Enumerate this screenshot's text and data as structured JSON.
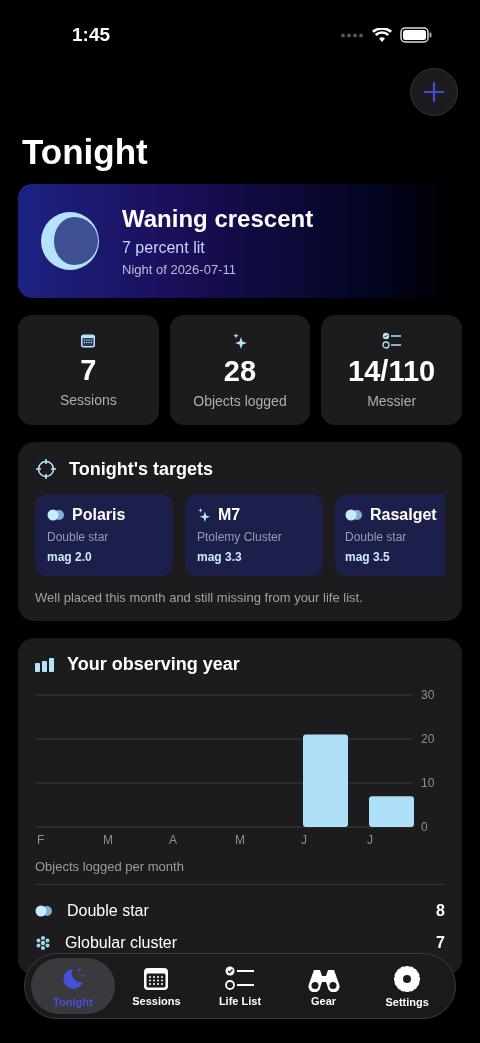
{
  "status_bar": {
    "time": "1:45"
  },
  "title": "Tonight",
  "moon": {
    "phase": "Waning crescent",
    "lit": "7 percent lit",
    "night": "Night of 2026-07-11"
  },
  "stats": [
    {
      "kind": "calendar",
      "value": "7",
      "label": "Sessions"
    },
    {
      "kind": "sparkles",
      "value": "28",
      "label": "Objects logged"
    },
    {
      "kind": "checklist",
      "value": "14/110",
      "label": "Messier"
    }
  ],
  "targets": {
    "title": "Tonight's targets",
    "items": [
      {
        "kind": "double",
        "name": "Polaris",
        "type": "Double star",
        "mag": "mag 2.0"
      },
      {
        "kind": "sparkles",
        "name": "M7",
        "type": "Ptolemy Cluster",
        "mag": "mag 3.3"
      },
      {
        "kind": "double",
        "name": "Rasalget",
        "type": "Double star",
        "mag": "mag 3.5"
      }
    ],
    "note": "Well placed this month and still missing from your life list."
  },
  "year": {
    "title": "Your observing year",
    "caption": "Objects logged per month",
    "chart_data": {
      "type": "bar",
      "categories": [
        "F",
        "M",
        "A",
        "M",
        "J",
        "J"
      ],
      "series": [
        {
          "color": "#aee0f8",
          "values": [
            0,
            0,
            0,
            0,
            21,
            7
          ]
        }
      ],
      "ylim": [
        0,
        30
      ],
      "yticks": [
        0,
        10,
        20,
        30
      ]
    },
    "rows": [
      {
        "kind": "double",
        "label": "Double star",
        "count": "8"
      },
      {
        "kind": "globular",
        "label": "Globular cluster",
        "count": "7"
      }
    ]
  },
  "tabs": [
    {
      "kind": "moon",
      "label": "Tonight",
      "selected": true
    },
    {
      "kind": "calendar",
      "label": "Sessions",
      "selected": false
    },
    {
      "kind": "checklist",
      "label": "Life List",
      "selected": false
    },
    {
      "kind": "binoculars",
      "label": "Gear",
      "selected": false
    },
    {
      "kind": "gear",
      "label": "Settings",
      "selected": false
    }
  ]
}
